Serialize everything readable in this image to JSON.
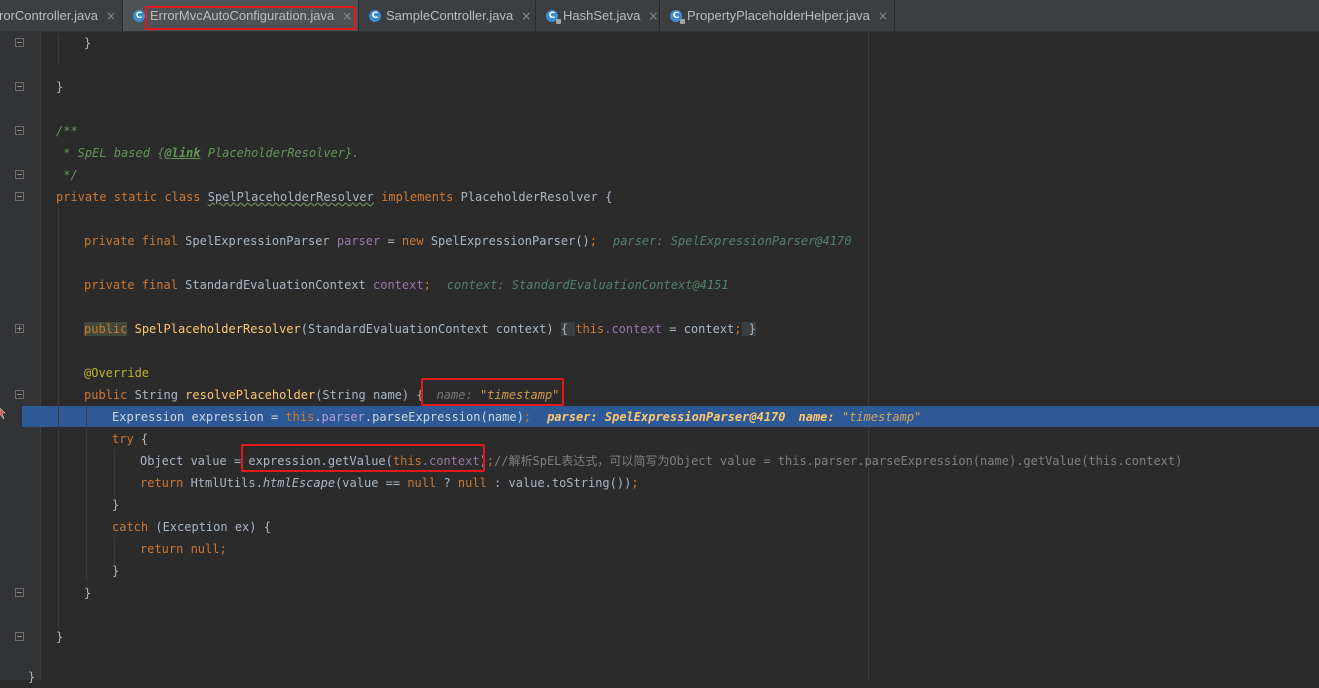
{
  "tabs": [
    {
      "label": "rorController.java",
      "active": false,
      "locked": false
    },
    {
      "label": "ErrorMvcAutoConfiguration.java",
      "active": true,
      "locked": false
    },
    {
      "label": "SampleController.java",
      "active": false,
      "locked": false
    },
    {
      "label": "HashSet.java",
      "active": false,
      "locked": true
    },
    {
      "label": "PropertyPlaceholderHelper.java",
      "active": false,
      "locked": true
    }
  ],
  "icons": {
    "class_icon": "C",
    "close_icon": "×"
  },
  "colors": {
    "highlight_box": "#e0191b",
    "execution_line": "#2d5a96"
  },
  "code": {
    "brace_close_inner": "}",
    "brace_close_outer": "}",
    "doc_open": "/**",
    "doc_body_1": " * SpEL based {",
    "doc_link_tag": "@link",
    "doc_body_2": " PlaceholderResolver}.",
    "doc_close": " */",
    "cls_kw": "private static class ",
    "cls_name": "SpelPlaceholderResolver",
    "cls_impl": " implements ",
    "cls_iface": "PlaceholderResolver {",
    "parser_kw": "private final ",
    "parser_type": "SpelExpressionParser ",
    "parser_field": "parser",
    "parser_eq": " = ",
    "parser_new": "new ",
    "parser_ctor": "SpelExpressionParser()",
    "parser_semi": ";",
    "parser_hint": "parser: SpelExpressionParser@4170",
    "ctx_kw": "private final ",
    "ctx_type": "StandardEvaluationContext ",
    "ctx_field": "context",
    "ctx_semi": ";",
    "ctx_hint": "context: StandardEvaluationContext@4151",
    "ctor_public": "public",
    "ctor_name": "SpelPlaceholderResolver",
    "ctor_params": "(StandardEvaluationContext context) ",
    "ctor_open": "{ ",
    "ctor_this": "this",
    "ctor_dot_field": ".context",
    "ctor_assign": " = context",
    "ctor_semi": ";",
    "ctor_close": " }",
    "override": "@Override",
    "method_kw": "public ",
    "method_ret": "String ",
    "method_name": "resolvePlaceholder",
    "method_params": "(String name) {",
    "method_hint_label": "name: ",
    "method_hint_value": "\"timestamp\"",
    "exec_type": "Expression expression = ",
    "exec_this": "this",
    "exec_dot": ".",
    "exec_field": "parser",
    "exec_call": ".parseExpression(name)",
    "exec_semi": ";",
    "exec_hint_parser": "parser: SpelExpressionParser@4170",
    "exec_hint_name_label": "name: ",
    "exec_hint_name_value": "\"timestamp\"",
    "try_kw": "try",
    "try_open": " {",
    "value_decl": "Object value = ",
    "value_call": "expression.getValue(",
    "value_this": "this",
    "value_dot_ctx": ".context",
    "value_close": ")",
    "value_semi": ";",
    "value_comment": "//解析SpEL表达式，可以简写为Object value = this.parser.parseExpression(name).getValue(this.context)",
    "ret_kw": "return ",
    "ret_util": "HtmlUtils.",
    "ret_method": "htmlEscape",
    "ret_args": "(value == ",
    "ret_null1": "null",
    "ret_q": " ? ",
    "ret_null2": "null",
    "ret_rest": " : value.toString())",
    "ret_semi": ";",
    "try_close": "}",
    "catch_kw": "catch",
    "catch_rest": " (Exception ex) {",
    "catch_ret_kw": "return ",
    "catch_null": "null",
    "catch_semi": ";",
    "catch_close": "}",
    "method_close": "}",
    "class_close": "}",
    "file_close": "}"
  }
}
